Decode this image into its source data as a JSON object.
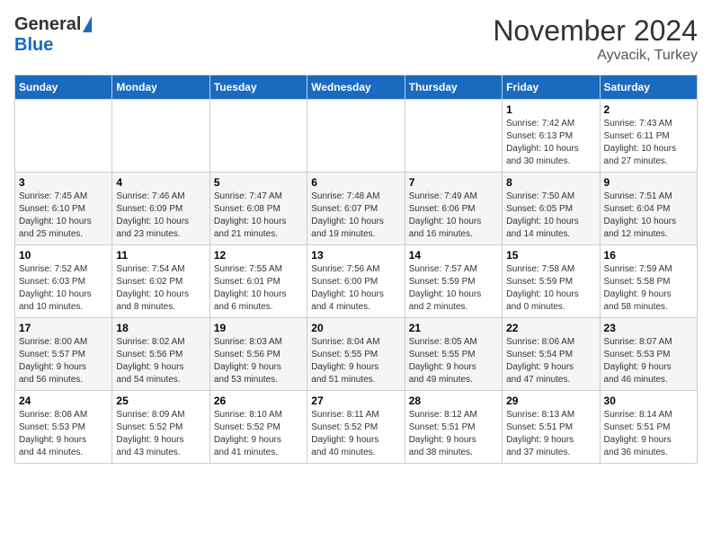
{
  "header": {
    "logo_general": "General",
    "logo_blue": "Blue",
    "month_title": "November 2024",
    "location": "Ayvacik, Turkey"
  },
  "weekdays": [
    "Sunday",
    "Monday",
    "Tuesday",
    "Wednesday",
    "Thursday",
    "Friday",
    "Saturday"
  ],
  "weeks": [
    [
      {
        "day": "",
        "info": ""
      },
      {
        "day": "",
        "info": ""
      },
      {
        "day": "",
        "info": ""
      },
      {
        "day": "",
        "info": ""
      },
      {
        "day": "",
        "info": ""
      },
      {
        "day": "1",
        "info": "Sunrise: 7:42 AM\nSunset: 6:13 PM\nDaylight: 10 hours\nand 30 minutes."
      },
      {
        "day": "2",
        "info": "Sunrise: 7:43 AM\nSunset: 6:11 PM\nDaylight: 10 hours\nand 27 minutes."
      }
    ],
    [
      {
        "day": "3",
        "info": "Sunrise: 7:45 AM\nSunset: 6:10 PM\nDaylight: 10 hours\nand 25 minutes."
      },
      {
        "day": "4",
        "info": "Sunrise: 7:46 AM\nSunset: 6:09 PM\nDaylight: 10 hours\nand 23 minutes."
      },
      {
        "day": "5",
        "info": "Sunrise: 7:47 AM\nSunset: 6:08 PM\nDaylight: 10 hours\nand 21 minutes."
      },
      {
        "day": "6",
        "info": "Sunrise: 7:48 AM\nSunset: 6:07 PM\nDaylight: 10 hours\nand 19 minutes."
      },
      {
        "day": "7",
        "info": "Sunrise: 7:49 AM\nSunset: 6:06 PM\nDaylight: 10 hours\nand 16 minutes."
      },
      {
        "day": "8",
        "info": "Sunrise: 7:50 AM\nSunset: 6:05 PM\nDaylight: 10 hours\nand 14 minutes."
      },
      {
        "day": "9",
        "info": "Sunrise: 7:51 AM\nSunset: 6:04 PM\nDaylight: 10 hours\nand 12 minutes."
      }
    ],
    [
      {
        "day": "10",
        "info": "Sunrise: 7:52 AM\nSunset: 6:03 PM\nDaylight: 10 hours\nand 10 minutes."
      },
      {
        "day": "11",
        "info": "Sunrise: 7:54 AM\nSunset: 6:02 PM\nDaylight: 10 hours\nand 8 minutes."
      },
      {
        "day": "12",
        "info": "Sunrise: 7:55 AM\nSunset: 6:01 PM\nDaylight: 10 hours\nand 6 minutes."
      },
      {
        "day": "13",
        "info": "Sunrise: 7:56 AM\nSunset: 6:00 PM\nDaylight: 10 hours\nand 4 minutes."
      },
      {
        "day": "14",
        "info": "Sunrise: 7:57 AM\nSunset: 5:59 PM\nDaylight: 10 hours\nand 2 minutes."
      },
      {
        "day": "15",
        "info": "Sunrise: 7:58 AM\nSunset: 5:59 PM\nDaylight: 10 hours\nand 0 minutes."
      },
      {
        "day": "16",
        "info": "Sunrise: 7:59 AM\nSunset: 5:58 PM\nDaylight: 9 hours\nand 58 minutes."
      }
    ],
    [
      {
        "day": "17",
        "info": "Sunrise: 8:00 AM\nSunset: 5:57 PM\nDaylight: 9 hours\nand 56 minutes."
      },
      {
        "day": "18",
        "info": "Sunrise: 8:02 AM\nSunset: 5:56 PM\nDaylight: 9 hours\nand 54 minutes."
      },
      {
        "day": "19",
        "info": "Sunrise: 8:03 AM\nSunset: 5:56 PM\nDaylight: 9 hours\nand 53 minutes."
      },
      {
        "day": "20",
        "info": "Sunrise: 8:04 AM\nSunset: 5:55 PM\nDaylight: 9 hours\nand 51 minutes."
      },
      {
        "day": "21",
        "info": "Sunrise: 8:05 AM\nSunset: 5:55 PM\nDaylight: 9 hours\nand 49 minutes."
      },
      {
        "day": "22",
        "info": "Sunrise: 8:06 AM\nSunset: 5:54 PM\nDaylight: 9 hours\nand 47 minutes."
      },
      {
        "day": "23",
        "info": "Sunrise: 8:07 AM\nSunset: 5:53 PM\nDaylight: 9 hours\nand 46 minutes."
      }
    ],
    [
      {
        "day": "24",
        "info": "Sunrise: 8:08 AM\nSunset: 5:53 PM\nDaylight: 9 hours\nand 44 minutes."
      },
      {
        "day": "25",
        "info": "Sunrise: 8:09 AM\nSunset: 5:52 PM\nDaylight: 9 hours\nand 43 minutes."
      },
      {
        "day": "26",
        "info": "Sunrise: 8:10 AM\nSunset: 5:52 PM\nDaylight: 9 hours\nand 41 minutes."
      },
      {
        "day": "27",
        "info": "Sunrise: 8:11 AM\nSunset: 5:52 PM\nDaylight: 9 hours\nand 40 minutes."
      },
      {
        "day": "28",
        "info": "Sunrise: 8:12 AM\nSunset: 5:51 PM\nDaylight: 9 hours\nand 38 minutes."
      },
      {
        "day": "29",
        "info": "Sunrise: 8:13 AM\nSunset: 5:51 PM\nDaylight: 9 hours\nand 37 minutes."
      },
      {
        "day": "30",
        "info": "Sunrise: 8:14 AM\nSunset: 5:51 PM\nDaylight: 9 hours\nand 36 minutes."
      }
    ]
  ]
}
